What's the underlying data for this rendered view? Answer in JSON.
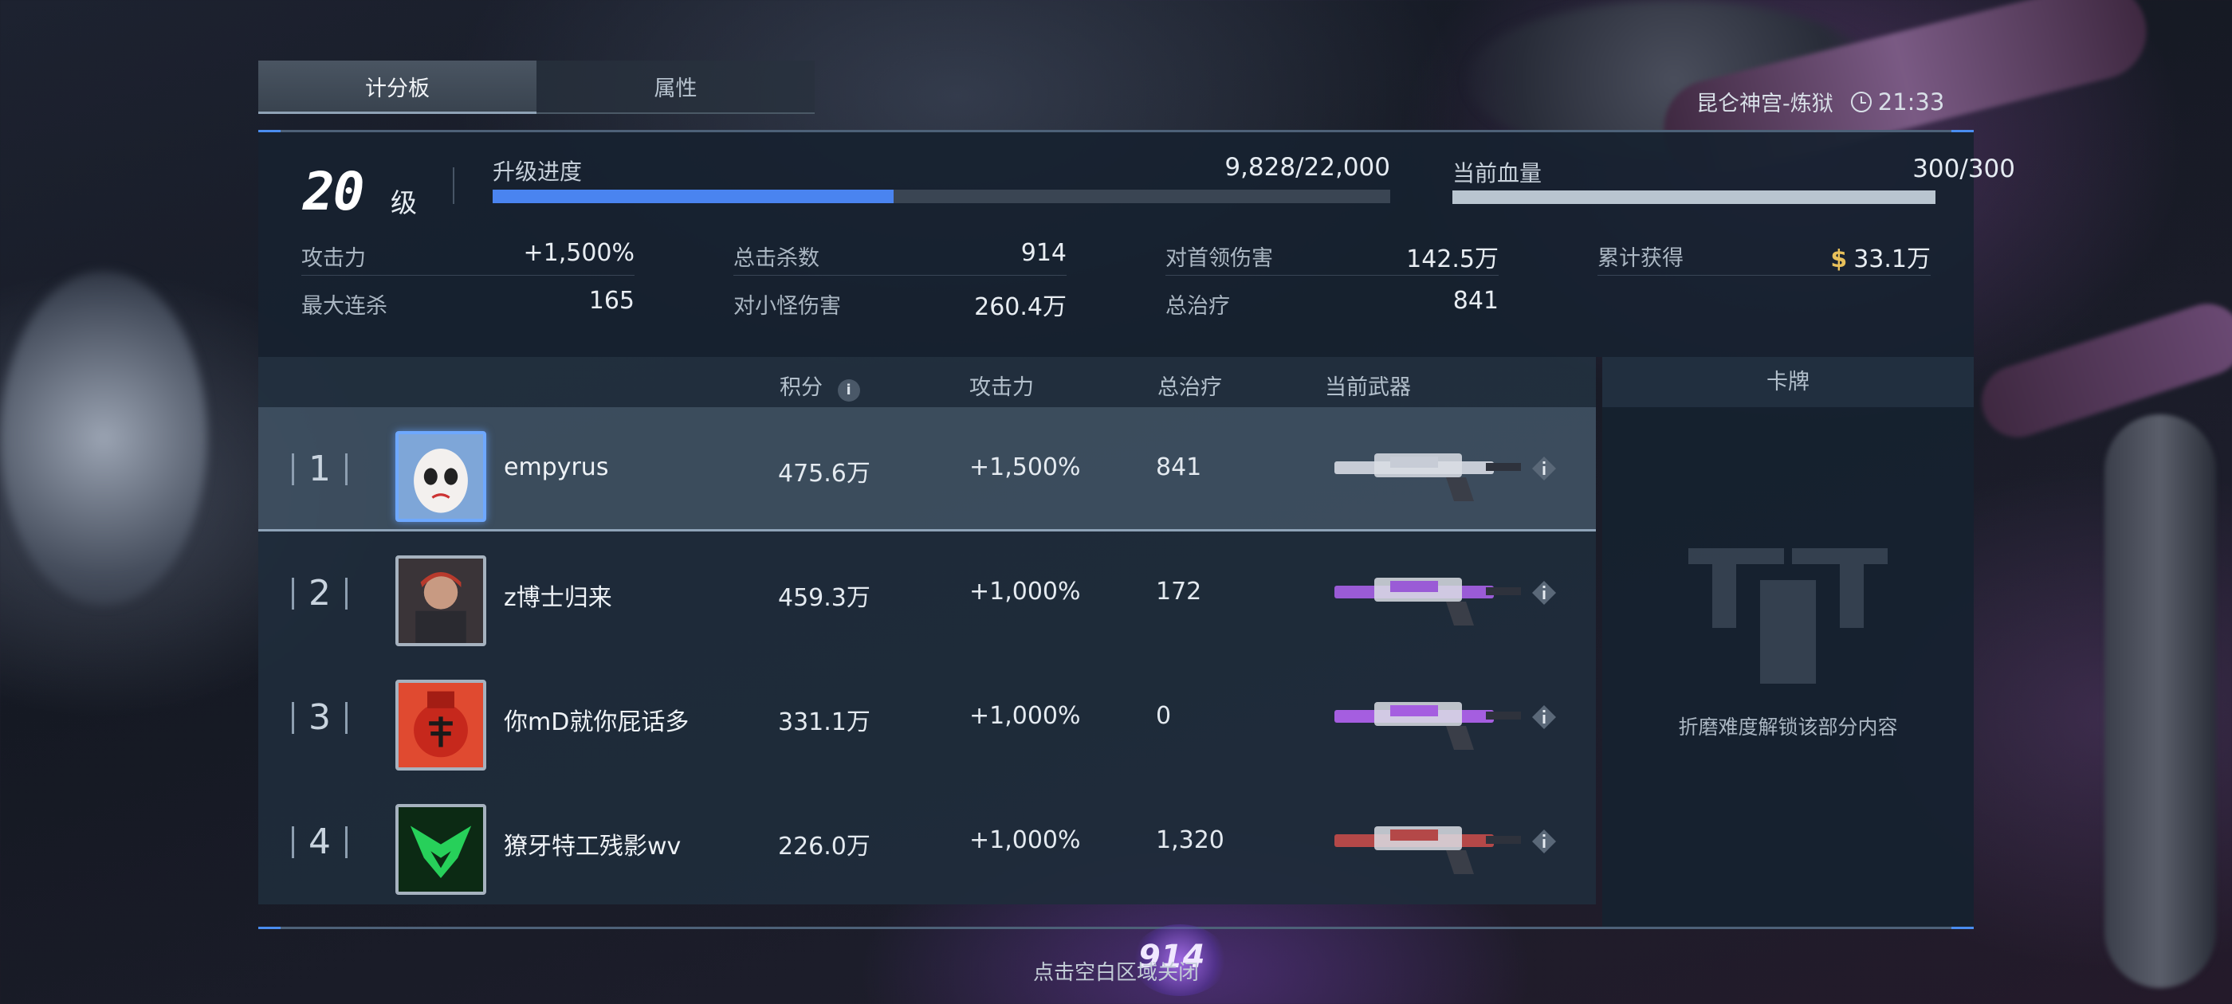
{
  "tabs": [
    {
      "label": "计分板",
      "active": true
    },
    {
      "label": "属性",
      "active": false
    }
  ],
  "location": {
    "map": "昆仑神宫-炼狱",
    "time": "21:33",
    "icon": "clock-icon"
  },
  "level": {
    "value": "20",
    "unit": "级"
  },
  "progress": {
    "label": "升级进度",
    "value": "9,828/22,000",
    "fraction": 0.4467
  },
  "health": {
    "label": "当前血量",
    "value": "300/300",
    "fraction": 1.0
  },
  "stats": {
    "attack": {
      "label": "攻击力",
      "value": "+1,500%"
    },
    "max_combo": {
      "label": "最大连杀",
      "value": "165"
    },
    "total_kills": {
      "label": "总击杀数",
      "value": "914"
    },
    "minion_damage": {
      "label": "对小怪伤害",
      "value": "260.4万"
    },
    "boss_damage": {
      "label": "对首领伤害",
      "value": "142.5万"
    },
    "total_heal": {
      "label": "总治疗",
      "value": "841"
    },
    "earned": {
      "label": "累计获得",
      "value": "33.1万",
      "icon": "$"
    }
  },
  "table": {
    "headers": {
      "score": "积分",
      "attack": "攻击力",
      "heal": "总治疗",
      "weapon": "当前武器"
    },
    "rows": [
      {
        "rank": "1",
        "name": "empyrus",
        "score": "475.6万",
        "attack": "+1,500%",
        "heal": "841",
        "avatar": "mask-avatar",
        "weapon_color": "#c7ccd6",
        "is_self": true
      },
      {
        "rank": "2",
        "name": "z博士归来",
        "score": "459.3万",
        "attack": "+1,000%",
        "heal": "172",
        "avatar": "soldier-avatar",
        "weapon_color": "#9a5bd6",
        "is_self": false
      },
      {
        "rank": "3",
        "name": "你mD就你屁话多",
        "score": "331.1万",
        "attack": "+1,000%",
        "heal": "0",
        "avatar": "red-bag-avatar",
        "weapon_color": "#a55ee0",
        "is_self": false
      },
      {
        "rank": "4",
        "name": "獠牙特工残影wv",
        "score": "226.0万",
        "attack": "+1,000%",
        "heal": "1,320",
        "avatar": "green-emblem-avatar",
        "weapon_color": "#b44848",
        "is_self": false
      }
    ]
  },
  "cards": {
    "title": "卡牌",
    "message": "折磨难度解锁该部分内容"
  },
  "footer": {
    "hint": "点击空白区域关闭",
    "counter": "914"
  },
  "colors": {
    "accent": "#4a84f0",
    "gold": "#e8c05a"
  }
}
